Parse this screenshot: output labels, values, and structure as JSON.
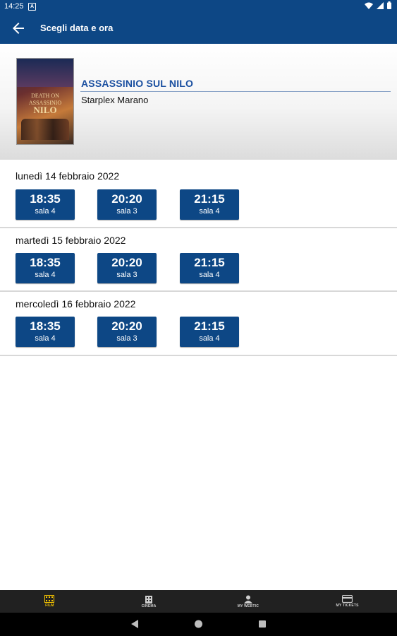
{
  "status_bar": {
    "time": "14:25",
    "notification_glyph": "A"
  },
  "app_bar": {
    "title": "Scegli data e ora"
  },
  "movie": {
    "title": "ASSASSINIO SUL NILO",
    "cinema": "Starplex Marano",
    "poster_text": {
      "line1": "DEATH ON",
      "line2": "ASSASSINIO",
      "line3": "NILO"
    }
  },
  "days": [
    {
      "label": "lunedì 14 febbraio 2022",
      "showtimes": [
        {
          "time": "18:35",
          "room": "sala 4"
        },
        {
          "time": "20:20",
          "room": "sala 3"
        },
        {
          "time": "21:15",
          "room": "sala 4"
        }
      ]
    },
    {
      "label": "martedì 15 febbraio 2022",
      "showtimes": [
        {
          "time": "18:35",
          "room": "sala 4"
        },
        {
          "time": "20:20",
          "room": "sala 3"
        },
        {
          "time": "21:15",
          "room": "sala 4"
        }
      ]
    },
    {
      "label": "mercoledì 16 febbraio 2022",
      "showtimes": [
        {
          "time": "18:35",
          "room": "sala 4"
        },
        {
          "time": "20:20",
          "room": "sala 3"
        },
        {
          "time": "21:15",
          "room": "sala 4"
        }
      ]
    }
  ],
  "bottom_nav": [
    {
      "label": "FILM",
      "icon": "film-icon",
      "active": true
    },
    {
      "label": "CINEMA",
      "icon": "cinema-building-icon",
      "active": false
    },
    {
      "label": "MY WEBTIC",
      "icon": "user-icon",
      "active": false
    },
    {
      "label": "MY TICKETS",
      "icon": "ticket-card-icon",
      "active": false
    }
  ],
  "colors": {
    "primary": "#0d4785",
    "accent_title": "#1a4fa0",
    "nav_active": "#f5c400",
    "nav_bg": "#212121"
  }
}
